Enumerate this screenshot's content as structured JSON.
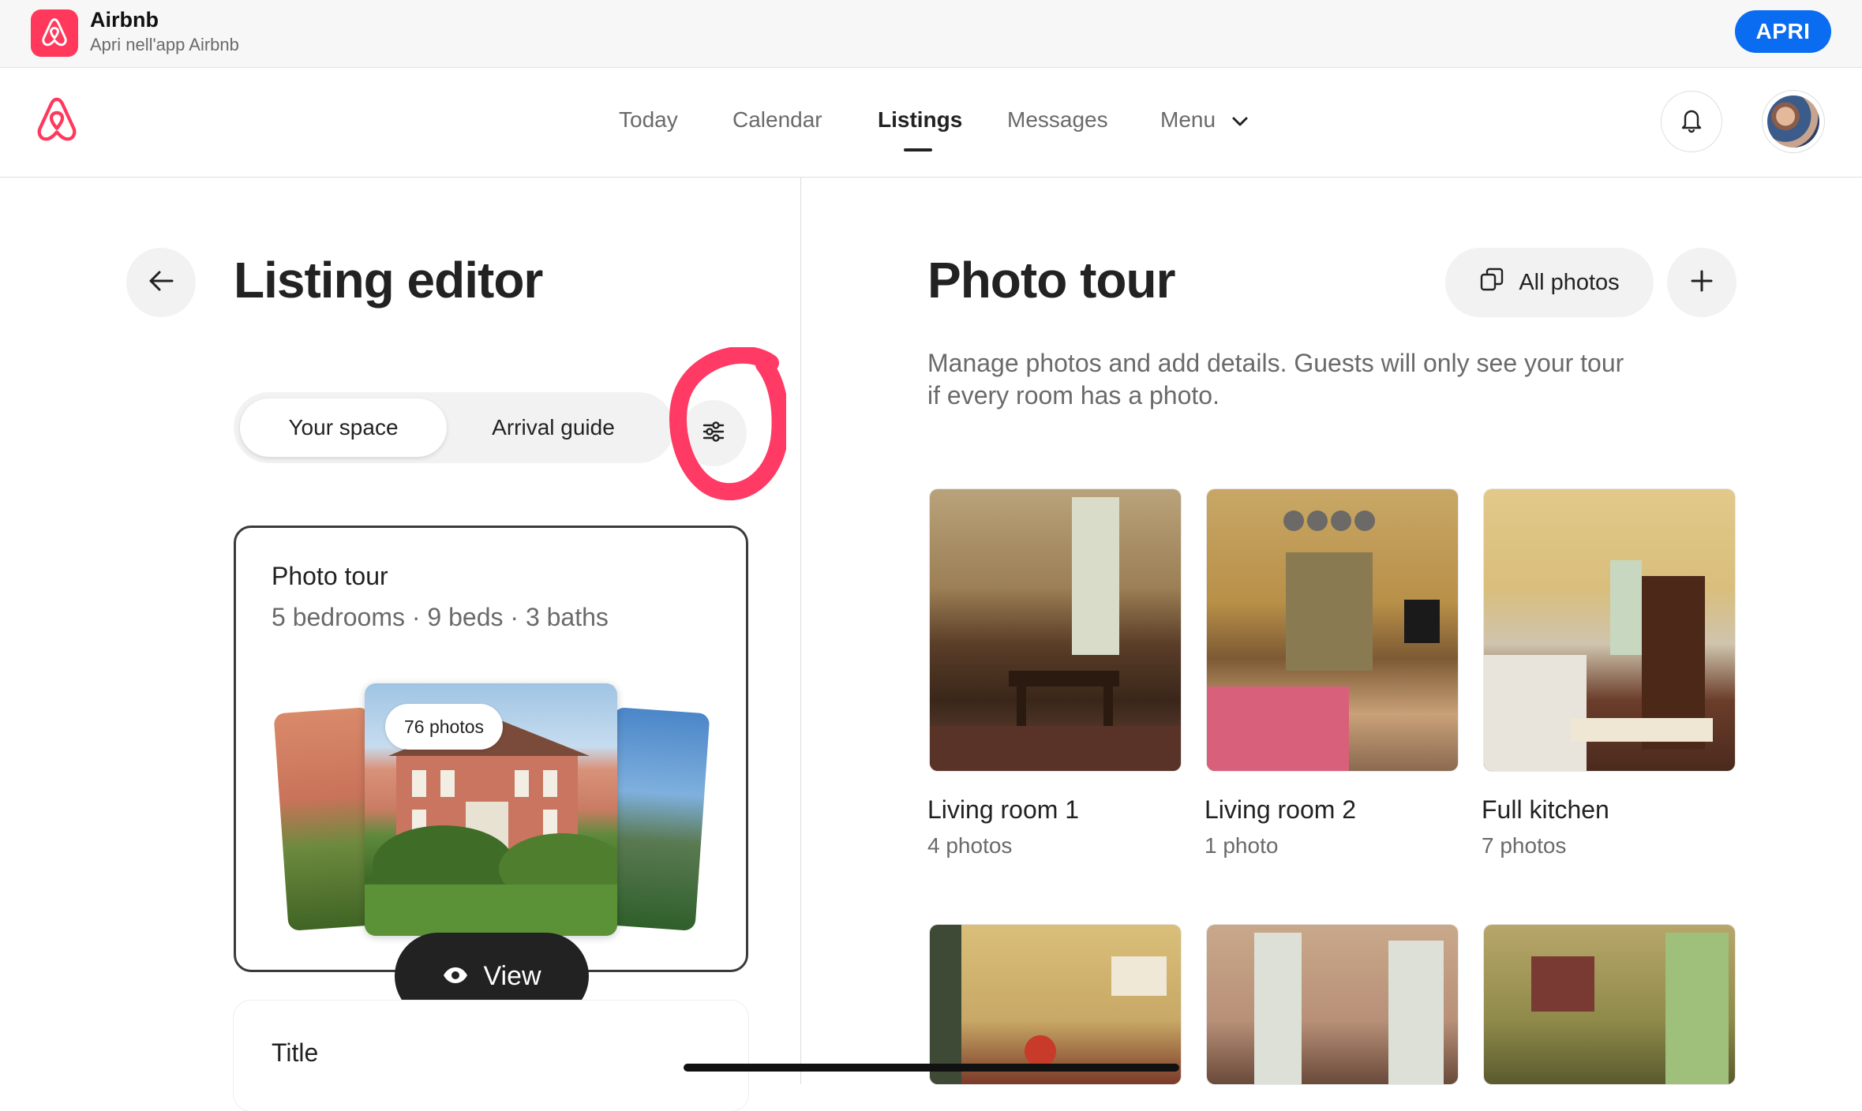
{
  "banner": {
    "app_name": "Airbnb",
    "subtitle": "Apri nell'app Airbnb",
    "open_label": "APRI",
    "brand_color": "#ff385c",
    "button_color": "#0a6cf0"
  },
  "nav": {
    "items": [
      {
        "label": "Today"
      },
      {
        "label": "Calendar"
      },
      {
        "label": "Listings",
        "active": true
      },
      {
        "label": "Messages"
      },
      {
        "label": "Menu"
      }
    ]
  },
  "editor": {
    "title": "Listing editor",
    "tabs": [
      {
        "label": "Your space",
        "active": true
      },
      {
        "label": "Arrival guide"
      }
    ],
    "photo_tour_card": {
      "title": "Photo tour",
      "details": "5 bedrooms · 9 beds · 3 baths",
      "photo_count": "76 photos",
      "view_label": "View"
    },
    "title_card": {
      "label": "Title"
    }
  },
  "photo_tour": {
    "title": "Photo tour",
    "all_photos_label": "All photos",
    "description": "Manage photos and add details. Guests will only see your tour if every room has a photo.",
    "rooms": [
      {
        "name": "Living room 1",
        "count": "4 photos"
      },
      {
        "name": "Living room 2",
        "count": "1 photo"
      },
      {
        "name": "Full kitchen",
        "count": "7 photos"
      }
    ]
  },
  "icons": [
    "airbnb-logo-icon",
    "bell-icon",
    "chevron-down-icon",
    "back-arrow-icon",
    "filter-sliders-icon",
    "eye-icon",
    "photos-stack-icon",
    "plus-icon"
  ]
}
